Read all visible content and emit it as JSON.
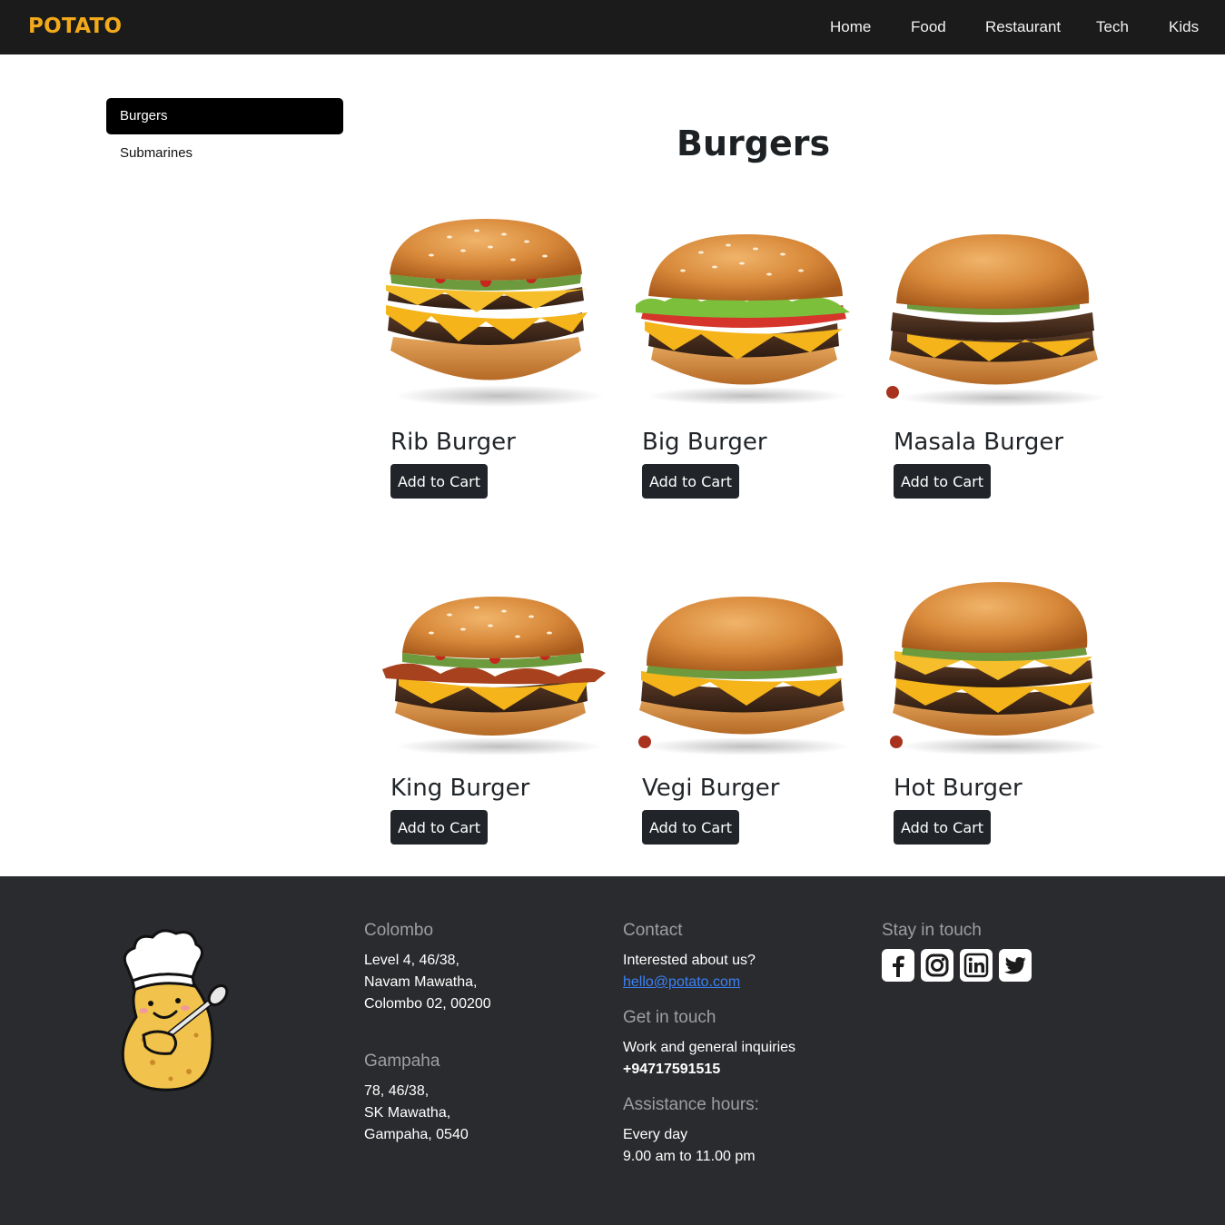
{
  "header": {
    "brand": "POTATO",
    "nav": [
      "Home",
      "Food",
      "Restaurant",
      "Tech",
      "Kids"
    ],
    "brand_color": "#f2a91b"
  },
  "sidebar": {
    "items": [
      {
        "label": "Burgers",
        "active": true
      },
      {
        "label": "Submarines",
        "active": false
      }
    ]
  },
  "main": {
    "title": "Burgers",
    "button_label": "Add to Cart",
    "products": [
      {
        "name": "Rib Burger"
      },
      {
        "name": "Big Burger"
      },
      {
        "name": "Masala Burger"
      },
      {
        "name": "King Burger"
      },
      {
        "name": "Vegi Burger"
      },
      {
        "name": "Hot Burger"
      }
    ]
  },
  "footer": {
    "colombo": {
      "heading": "Colombo",
      "lines": [
        "Level 4, 46/38,",
        "Navam Mawatha,",
        "Colombo 02, 00200"
      ]
    },
    "gampaha": {
      "heading": "Gampaha",
      "lines": [
        "78, 46/38,",
        "SK Mawatha,",
        "Gampaha, 0540"
      ]
    },
    "contact": {
      "heading": "Contact",
      "text": "Interested about us?",
      "email": "hello@potato.com"
    },
    "get_in_touch": {
      "heading": "Get in touch",
      "text": "Work and general inquiries",
      "phone": "+94717591515"
    },
    "hours": {
      "heading": "Assistance hours:",
      "days": "Every day",
      "time": "9.00 am to 11.00 pm"
    },
    "social": {
      "heading": "Stay in touch",
      "icons": [
        "facebook-icon",
        "instagram-icon",
        "linkedin-icon",
        "twitter-icon"
      ]
    }
  }
}
